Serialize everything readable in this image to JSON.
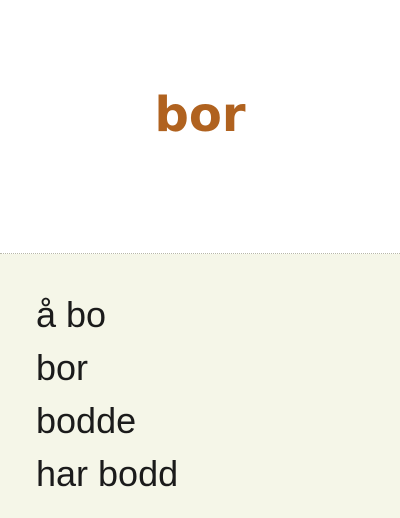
{
  "card": {
    "headword": "bor",
    "headword_color": "#b0621f",
    "bottom_background": "#f5f6e8",
    "forms": [
      "å bo",
      "bor",
      "bodde",
      "har bodd"
    ]
  }
}
